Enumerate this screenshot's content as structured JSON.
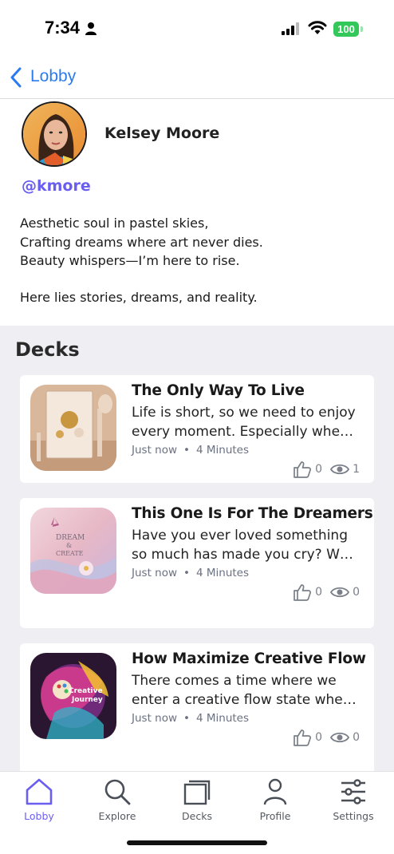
{
  "status_bar": {
    "time": "7:34",
    "battery": "100"
  },
  "nav": {
    "back_label": "Lobby"
  },
  "profile": {
    "name": "Kelsey Moore",
    "handle": "@kmore",
    "bio_lines": [
      "Aesthetic soul in pastel skies,",
      "Crafting dreams where art never dies.",
      "Beauty whispers—I’m here to rise.",
      "Here lies stories, dreams, and reality."
    ]
  },
  "decks": {
    "heading": "Decks",
    "items": [
      {
        "title": "The Only Way To Live",
        "desc_line1": "Life is short, so we need to enjoy",
        "desc_line2": "every moment. Especially whe…",
        "time": "Just now",
        "separator": "•",
        "duration": "4 Minutes",
        "likes": "0",
        "views": "1"
      },
      {
        "title": "This One Is For The Dreamers",
        "desc_line1": "Have you ever loved something",
        "desc_line2": "so much has made you cry? W…",
        "time": "Just now",
        "separator": "•",
        "duration": "4 Minutes",
        "likes": "0",
        "views": "0"
      },
      {
        "title": "How Maximize Creative Flow",
        "desc_line1": "There comes a time where we",
        "desc_line2": "enter a creative flow state whe…",
        "time": "Just now",
        "separator": "•",
        "duration": "4 Minutes",
        "likes": "0",
        "views": "0"
      }
    ]
  },
  "tabs": [
    {
      "label": "Lobby",
      "icon": "home-icon",
      "active": true
    },
    {
      "label": "Explore",
      "icon": "search-icon",
      "active": false
    },
    {
      "label": "Decks",
      "icon": "cards-icon",
      "active": false
    },
    {
      "label": "Profile",
      "icon": "person-icon",
      "active": false
    },
    {
      "label": "Settings",
      "icon": "sliders-icon",
      "active": false
    }
  ],
  "colors": {
    "accent": "#6a5ef0",
    "link_blue": "#2b7bf0",
    "section_bg": "#efeff3",
    "battery_green": "#34c759"
  }
}
